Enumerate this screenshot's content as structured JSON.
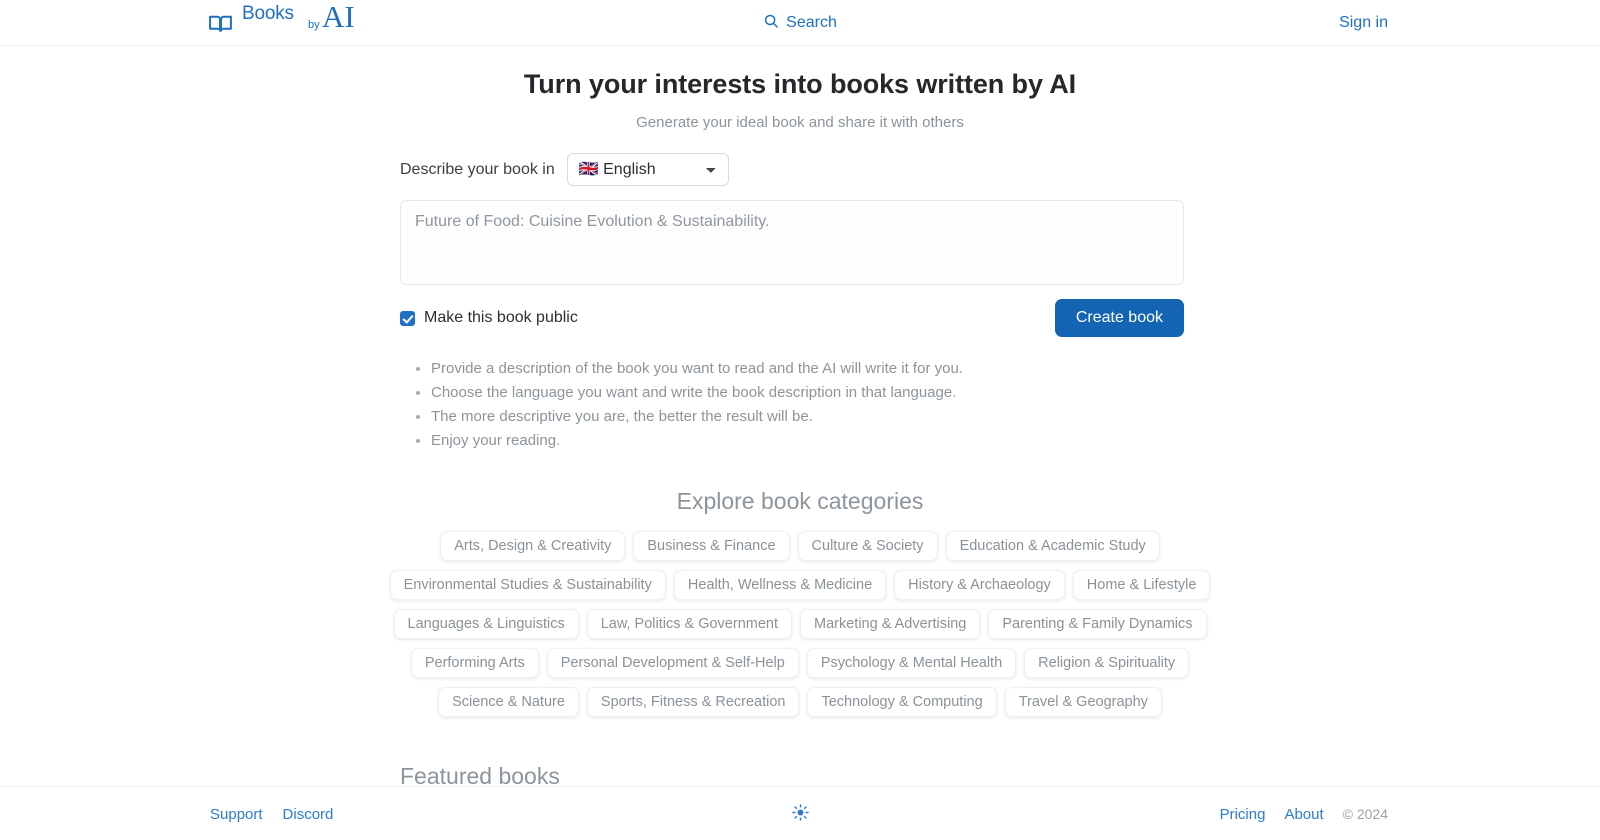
{
  "header": {
    "brand": {
      "icon": "open-book-icon",
      "word_books": "Books",
      "word_by": "by",
      "word_ai": "AI",
      "color": "#1f6fc4"
    },
    "search": {
      "icon": "search-icon",
      "label": "Search"
    },
    "signin": {
      "label": "Sign in"
    }
  },
  "hero": {
    "title": "Turn your interests into books written by AI",
    "subtitle": "Generate your ideal book and share it with others"
  },
  "form": {
    "describe_label": "Describe your book in",
    "language": {
      "selected": "🇬🇧 English",
      "options": [
        "🇬🇧 English"
      ]
    },
    "description": {
      "value": "",
      "placeholder": "Future of Food: Cuisine Evolution & Sustainability."
    },
    "public_checkbox": {
      "label": "Make this book public",
      "checked": true
    },
    "create_button": {
      "label": "Create book",
      "color": "#1464b4"
    }
  },
  "tips": [
    "Provide a description of the book you want to read and the AI will write it for you.",
    "Choose the language you want and write the book description in that language.",
    "The more descriptive you are, the better the result will be.",
    "Enjoy your reading."
  ],
  "categories": {
    "title": "Explore book categories",
    "rows": [
      [
        "Arts, Design & Creativity",
        "Business & Finance",
        "Culture & Society",
        "Education & Academic Study"
      ],
      [
        "Environmental Studies & Sustainability",
        "Health, Wellness & Medicine",
        "History & Archaeology",
        "Home & Lifestyle"
      ],
      [
        "Languages & Linguistics",
        "Law, Politics & Government",
        "Marketing & Advertising",
        "Parenting & Family Dynamics"
      ],
      [
        "Performing Arts",
        "Personal Development & Self-Help",
        "Psychology & Mental Health",
        "Religion & Spirituality"
      ],
      [
        "Science & Nature",
        "Sports, Fitness & Recreation",
        "Technology & Computing",
        "Travel & Geography"
      ]
    ]
  },
  "featured": {
    "title": "Featured books"
  },
  "footer": {
    "left_links": [
      "Support",
      "Discord"
    ],
    "theme_toggle": {
      "icon": "sun-icon",
      "color": "#2b7bd4"
    },
    "right_links": [
      "Pricing",
      "About"
    ],
    "copyright": "© 2024"
  }
}
